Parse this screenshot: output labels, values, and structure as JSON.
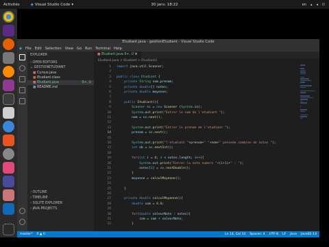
{
  "topbar": {
    "activities": "Activités",
    "app": "Visual Studio Code",
    "clock": "30 janv. 18:22",
    "lang": "en"
  },
  "window": {
    "title": "Etudiant.java - gestionEtudiant - Visual Studio Code"
  },
  "menu": [
    "File",
    "Edit",
    "Selection",
    "View",
    "Go",
    "Run",
    "Terminal",
    "Help"
  ],
  "sidebar": {
    "header": "EXPLORER",
    "open_editors": "OPEN EDITORS",
    "project": "GESTIONETUDIANT",
    "files": [
      {
        "name": "Cursus.java",
        "color": "#d16969"
      },
      {
        "name": "Etudiant.class",
        "color": "#cc6633"
      },
      {
        "name": "Etudiant.java",
        "color": "#d16969",
        "badge": "9+, U"
      },
      {
        "name": "README.md",
        "color": "#519aba"
      }
    ],
    "outline": "OUTLINE",
    "timeline": "TIMELINE",
    "sqlite": "SQLITE EXPLORER",
    "java_projects": "JAVA PROJECTS"
  },
  "tab": {
    "label": "Etudiant.java",
    "modified": "9+, U"
  },
  "breadcrumb": "Etudiant.java > Etudiant > Etudiant()",
  "code_lines": [
    {
      "n": "1",
      "html": "<span class='k'>import</span> <span class='p'>java.util.Scanner;</span>"
    },
    {
      "n": "2",
      "html": ""
    },
    {
      "n": "3",
      "html": "<span class='k'>public class</span> <span class='t'>Etudiant</span> <span class='p'>{</span>"
    },
    {
      "n": "4",
      "html": "    <span class='k'>private</span> <span class='t'>String</span> <span class='v'>nom,prenom</span><span class='p'>;</span>"
    },
    {
      "n": "5",
      "html": "    <span class='k'>private</span> <span class='k'>double</span><span class='p'>[]</span> <span class='v'>notes</span><span class='p'>;</span>"
    },
    {
      "n": "6",
      "html": "    <span class='k'>private</span> <span class='k'>double</span> <span class='v'>moyenne</span><span class='p'>;</span>"
    },
    {
      "n": "7",
      "html": ""
    },
    {
      "n": "8",
      "html": "    <span class='k'>public</span> <span class='f'>Etudiant</span><span class='p'>(){</span>"
    },
    {
      "n": "9",
      "html": "        <span class='t'>Scanner</span> <span class='v'>sc</span> <span class='p'>=</span> <span class='k'>new</span> <span class='f'>Scanner</span> <span class='p'>(</span><span class='t'>System</span><span class='p'>.</span><span class='v'>in</span><span class='p'>);</span>"
    },
    {
      "n": "10",
      "html": "        <span class='t'>System</span><span class='p'>.</span><span class='v'>out</span><span class='p'>.</span><span class='f'>print</span><span class='p'>(</span><span class='s'>\"Entrer le nom de l'etudiant \"</span><span class='p'>);</span>"
    },
    {
      "n": "11",
      "html": "        <span class='v'>nom</span> <span class='p'>=</span> <span class='v'>sc</span><span class='p'>.</span><span class='f'>next</span><span class='p'>();</span>"
    },
    {
      "n": "12",
      "html": ""
    },
    {
      "n": "13",
      "html": "        <span class='t'>System</span><span class='p'>.</span><span class='v'>out</span><span class='p'>.</span><span class='f'>print</span><span class='p'>(</span><span class='s'>\"Entrer le prenom de l'etudiant \"</span><span class='p'>);</span>"
    },
    {
      "n": "14",
      "html": "        <span class='v'>prenom</span> <span class='p'>=</span> <span class='v'>sc</span><span class='p'>.</span><span class='f'>next</span><span class='p'>();</span>"
    },
    {
      "n": "15",
      "html": ""
    },
    {
      "n": "16",
      "html": "        <span class='t'>System</span><span class='p'>.</span><span class='v'>out</span><span class='p'>.</span><span class='f'>print</span><span class='p'>(</span><span class='s'>\"l'etudiant \"</span><span class='p'>+</span><span class='v'>prenom</span><span class='p'>+</span><span class='s'>\" \"</span><span class='p'>+</span><span class='v'>nom</span><span class='p'>+</span><span class='s'>\" possede combien de notes \"</span><span class='p'>);</span>"
    },
    {
      "n": "17",
      "html": "        <span class='k'>int</span> <span class='v'>nb</span> <span class='p'>=</span> <span class='v'>sc</span><span class='p'>.</span><span class='f'>nextInt</span><span class='p'>();</span>"
    },
    {
      "n": "18",
      "html": ""
    },
    {
      "n": "19",
      "html": "        <span class='c'>for</span><span class='p'>(</span><span class='k'>int</span> <span class='v'>i</span> <span class='p'>=</span> <span class='n'>0</span><span class='p'>;</span> <span class='v'>i</span> <span class='p'>&lt;</span> <span class='v'>notes</span><span class='p'>.</span><span class='v'>length</span><span class='p'>;</span> <span class='v'>i</span><span class='p'>++){</span>"
    },
    {
      "n": "20",
      "html": "            <span class='t'>System</span><span class='p'>.</span><span class='v'>out</span><span class='p'>.</span><span class='f'>print</span><span class='p'>(</span><span class='s'>\"Entrer la note numero \"</span><span class='p'>+(</span><span class='v'>i</span><span class='p'>+</span><span class='n'>1</span><span class='p'>)+</span><span class='s'>\" : \"</span><span class='p'>);</span>"
    },
    {
      "n": "21",
      "html": "            <span class='v'>notes</span><span class='p'>[</span><span class='v'>i</span><span class='p'>]</span> <span class='p'>=</span> <span class='v'>sc</span><span class='p'>.</span><span class='f'>nextDouble</span><span class='p'>();</span>"
    },
    {
      "n": "22",
      "html": "        <span class='p'>}</span>"
    },
    {
      "n": "23",
      "html": "        <span class='v'>moyenne</span> <span class='p'>=</span> <span class='f'>calculMoyenne</span><span class='p'>();</span>"
    },
    {
      "n": "24",
      "html": ""
    },
    {
      "n": "25",
      "html": "    <span class='p'>}</span>"
    },
    {
      "n": "26",
      "html": ""
    },
    {
      "n": "27",
      "html": "    <span class='k'>private</span> <span class='k'>double</span> <span class='f'>calculMoyenne</span><span class='p'>(){</span>"
    },
    {
      "n": "28",
      "html": "        <span class='k'>double</span> <span class='v'>som</span> <span class='p'>=</span> <span class='n'>0.0</span><span class='p'>;</span>"
    },
    {
      "n": "29",
      "html": ""
    },
    {
      "n": "30",
      "html": "        <span class='c'>for</span><span class='p'>(</span><span class='k'>double</span> <span class='v'>valeurNote</span> <span class='p'>:</span> <span class='v'>notes</span><span class='p'>){</span>"
    },
    {
      "n": "31",
      "html": "            <span class='v'>som</span> <span class='p'>=</span> <span class='v'>som</span> <span class='p'>+</span> <span class='v'>valeurNote</span><span class='p'>;</span>"
    },
    {
      "n": "32",
      "html": "        <span class='p'>}</span>"
    }
  ],
  "status": {
    "branch": "master*",
    "errors": "0 ▲ 0",
    "position": "Ln 14, Col 33",
    "spaces": "Spaces: 4",
    "encoding": "UTF-8",
    "eol": "LF",
    "language": "Java",
    "jdk": "JavaSE-14"
  }
}
